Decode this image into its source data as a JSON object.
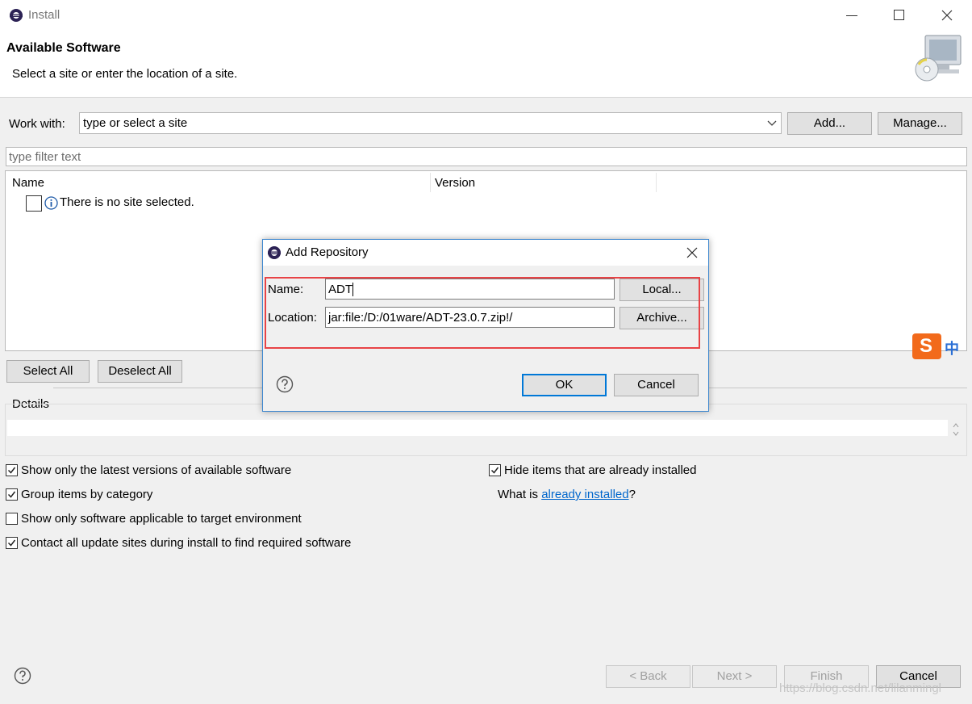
{
  "window": {
    "title": "Install"
  },
  "header": {
    "title": "Available Software",
    "description": "Select a site or enter the location of a site."
  },
  "work_with": {
    "label": "Work with:",
    "value": "type or select a site",
    "add_label": "Add...",
    "manage_label": "Manage..."
  },
  "filter": {
    "placeholder": "type filter text"
  },
  "table": {
    "columns": [
      "Name",
      "Version"
    ],
    "rows": [
      {
        "name": "There is no site selected.",
        "checked": false
      }
    ]
  },
  "selection_buttons": {
    "select_all": "Select All",
    "deselect_all": "Deselect All"
  },
  "details": {
    "label": "Details"
  },
  "options": {
    "latest_versions": {
      "label": "Show only the latest versions of available software",
      "checked": true
    },
    "group_by_category": {
      "label": "Group items by category",
      "checked": true
    },
    "applicable_only": {
      "label": "Show only software applicable to target environment",
      "checked": false
    },
    "contact_all_sites": {
      "label": "Contact all update sites during install to find required software",
      "checked": true
    },
    "hide_installed": {
      "label": "Hide items that are already installed",
      "checked": true
    },
    "what_is_prefix": "What is ",
    "already_installed_link": "already installed",
    "what_is_suffix": "?"
  },
  "footer": {
    "back": "< Back",
    "next": "Next >",
    "finish": "Finish",
    "cancel": "Cancel"
  },
  "dialog": {
    "title": "Add Repository",
    "name_label": "Name:",
    "name_value": "ADT",
    "location_label": "Location:",
    "location_value": "jar:file:/D:/01ware/ADT-23.0.7.zip!/",
    "local_button": "Local...",
    "archive_button": "Archive...",
    "ok": "OK",
    "cancel": "Cancel"
  },
  "ime": {
    "mode": "中"
  },
  "watermark": "https://blog.csdn.net/lilanmingl",
  "colors": {
    "link": "#0066cc",
    "highlight_box": "#e84346",
    "dialog_border": "#3f88cf"
  }
}
